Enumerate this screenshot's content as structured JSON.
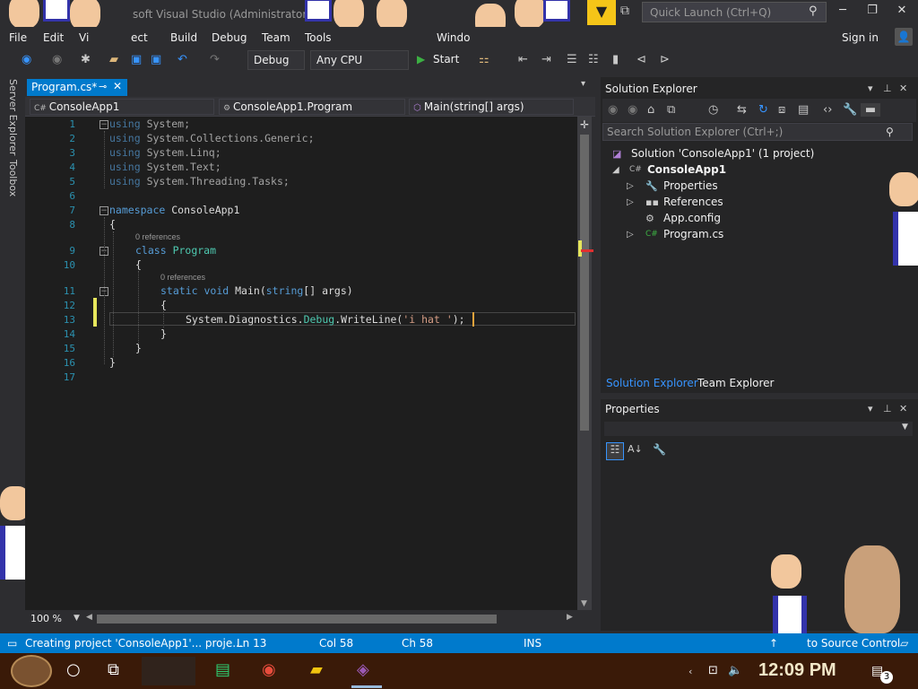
{
  "window": {
    "title": "soft Visual Studio  (Administrator)"
  },
  "quicklaunch": {
    "placeholder": "Quick Launch (Ctrl+Q)"
  },
  "menu": [
    "File",
    "Edit",
    "Vi",
    "ect",
    "Build",
    "Debug",
    "Team",
    "Tools",
    "Windo"
  ],
  "signin": "Sign in",
  "toolbar": {
    "config": "Debug",
    "platform": "Any CPU",
    "start": "Start"
  },
  "sidebar_tabs": [
    "Server Explorer",
    "Toolbox"
  ],
  "doc_tab": {
    "label": "Program.cs*",
    "pin": "⊸",
    "close": "✕"
  },
  "navbar": {
    "project": "ConsoleApp1",
    "class": "ConsoleApp1.Program",
    "member": "Main(string[] args)"
  },
  "code": {
    "lines": [
      "1",
      "2",
      "3",
      "4",
      "5",
      "6",
      "7",
      "8",
      "9",
      "10",
      "11",
      "12",
      "13",
      "14",
      "15",
      "16",
      "17"
    ],
    "using1": "System;",
    "using2": "System.Collections.Generic;",
    "using3": "System.Linq;",
    "using4": "System.Text;",
    "using5": "System.Threading.Tasks;",
    "kw_using": "using",
    "kw_namespace": "namespace",
    "ns_name": "ConsoleApp1",
    "brace_open": "{",
    "brace_close": "}",
    "refs": "0 references",
    "kw_class": "class",
    "class_name": "Program",
    "kw_static": "static",
    "kw_void": "void",
    "main_sig": "Main(",
    "kw_string": "string",
    "main_args": "[] args)",
    "call_ns": "System.Diagnostics.",
    "call_cls": "Debug",
    "call_method": ".WriteLine(",
    "call_str": "'i hat '",
    "call_end": ");"
  },
  "zoom": "100 %",
  "solution_explorer": {
    "title": "Solution Explorer",
    "search": "Search Solution Explorer (Ctrl+;)",
    "solution": "Solution 'ConsoleApp1' (1 project)",
    "project": "ConsoleApp1",
    "items": [
      "Properties",
      "References",
      "App.config",
      "Program.cs"
    ],
    "tabs": [
      "Solution Explorer",
      "Team Explorer"
    ]
  },
  "properties": {
    "title": "Properties"
  },
  "status": {
    "message": "Creating project 'ConsoleApp1'... proje...",
    "ln": "Ln 13",
    "col": "Col 58",
    "ch": "Ch 58",
    "ins": "INS",
    "source": "to Source Control"
  },
  "taskbar": {
    "time": "12:09 PM",
    "badge": "3"
  },
  "colors": {
    "accent": "#007acc",
    "editor_bg": "#1e1e1e",
    "keyword": "#569cd6",
    "type": "#4ec9b0",
    "string": "#d69d85"
  }
}
